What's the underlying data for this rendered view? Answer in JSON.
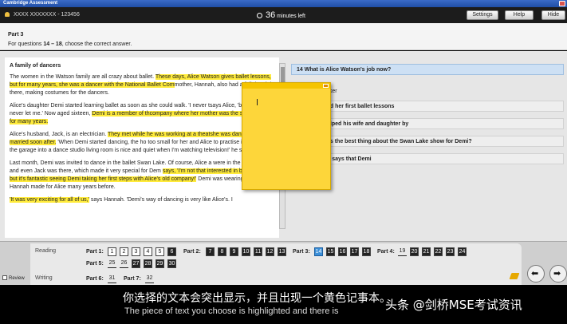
{
  "window": {
    "title": "Cambridge Assessment"
  },
  "topbar": {
    "candidate": "XXXX XXXXXXX - 123456",
    "timer_value": "36",
    "timer_unit": "minutes left",
    "settings_label": "Settings",
    "help_label": "Help",
    "hide_label": "Hide"
  },
  "header": {
    "part": "Part 3",
    "instr_pre": "For questions ",
    "instr_range": "14 – 18",
    "instr_post": ", choose the correct answer."
  },
  "passage": {
    "title": "A family of dancers",
    "p1a": "The women in the Watson family are all crazy about ballet. ",
    "p1b": "These days, Alice Watson gives ballet lessons, but for many years, she was a dancer with the National Ballet Com",
    "p1c": "mother, Hannah, also had a full-time job there, making costumes for the dancers.",
    "p2a": "Alice's daughter Demi started learning ballet as soon as she could walk. 'I never t",
    "p2b": "says Alice, 'because she never let me.' Now aged sixteen, ",
    "p2c": "Demi is a member of th",
    "p2d": "company where her mother was the star dancer for many years.",
    "p3a": "Alice's husband, Jack, is an electrician. ",
    "p3b": "They met while he was working at a theat",
    "p3c": "she was dancing and got married soon after.",
    "p3d": " 'When Demi started dancing, the ho",
    "p3e": "too small for her and Alice to practise in so I made the garage into a dance studio",
    "p3f": "living room is nice and quiet when I'm watching television!' he says.",
    "p4a": "Last month, Demi was invited to dance in the ballet Swan Lake. Of course, Alice a",
    "p4b": "were in the audience and even Jack was there, which made it very special for Dem",
    "p4c": "says, 'I'm not that interested in ballet myself but it's fantastic seeing Demi taking her first steps with Alice's old company!'",
    "p4d": " Demi was wearing a dress that Hannah made for Alice many years before.",
    "p5a": "'It was very exciting for all of us,'",
    "p5b": " says Hannah. 'Demi's way of dancing is very like Alice's. I"
  },
  "questions": {
    "q14": "14  What is Alice Watson's job now?",
    "frag1": "aker",
    "frag2": "ad her first ballet lessons",
    "frag3": "elped his wife and daughter by",
    "frag4": "as the best thing about the Swan Lake show for Demi?",
    "frag5": "n says that Demi"
  },
  "footer": {
    "review_label": "Review",
    "reading_label": "Reading",
    "writing_label": "Writing",
    "part1_label": "Part 1:",
    "part2_label": "Part 2:",
    "part3_label": "Part 3:",
    "part4_label": "Part 4:",
    "part5_label": "Part 5:",
    "part6_label": "Part 6:",
    "part7_label": "Part 7:",
    "reading_part1": [
      "1",
      "2",
      "3",
      "4",
      "5",
      "6"
    ],
    "reading_part2": [
      "7",
      "8",
      "9",
      "10",
      "11",
      "12",
      "13"
    ],
    "reading_part3": [
      "14",
      "15",
      "16",
      "17",
      "18"
    ],
    "reading_part4": [
      "19",
      "20",
      "21",
      "22",
      "23",
      "24"
    ],
    "reading_part5": [
      "25",
      "26",
      "27",
      "28",
      "29",
      "30"
    ],
    "writing_part6": "31",
    "writing_part7": "32"
  },
  "subtitle": {
    "cn": "你选择的文本会突出显示，并且出现一个黄色记事本。",
    "en": "The piece of text you choose is highlighted and there is",
    "watermark": "头条 @剑桥MSE考试资讯"
  }
}
